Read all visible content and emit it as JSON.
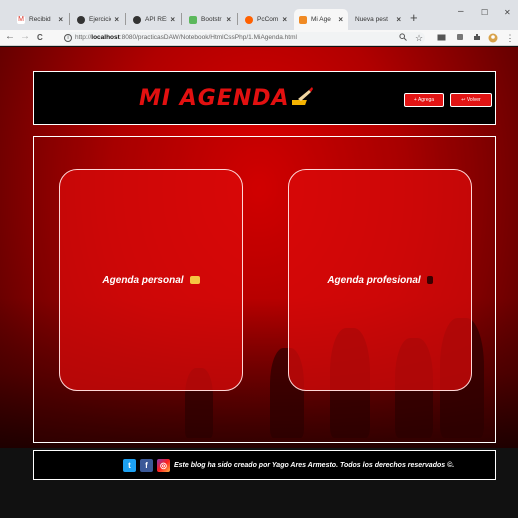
{
  "browser": {
    "tabs": [
      {
        "label": "Recibid",
        "favicon": "gmail-icon"
      },
      {
        "label": "Ejercicio",
        "favicon": "github-icon"
      },
      {
        "label": "API RES",
        "favicon": "github-icon"
      },
      {
        "label": "Bootstr",
        "favicon": "bootstrap-icon"
      },
      {
        "label": "PcCom",
        "favicon": "pccomponentes-icon"
      },
      {
        "label": "Mi Age",
        "favicon": "agenda-icon"
      },
      {
        "label": "Nueva pest",
        "favicon": ""
      }
    ],
    "close_glyph": "×",
    "new_tab_glyph": "+",
    "window_controls": {
      "minimize": "–",
      "maximize": "☐",
      "close": "✕"
    },
    "nav": {
      "back": "←",
      "forward": "→",
      "reload": "C"
    },
    "url": {
      "prefix": "http://",
      "host": "localhost",
      "path": ":8080/practicasDAW/Notebook/HtmlCssPhp/1.MiAgenda.html"
    }
  },
  "header": {
    "title": "MI AGENDA",
    "buttons": [
      {
        "label": "+ Agrega",
        "icon": "plus-icon"
      },
      {
        "label": "↩ Volver",
        "icon": "back-icon"
      }
    ]
  },
  "cards": [
    {
      "label": "Agenda personal",
      "icon": "notebook-emoji"
    },
    {
      "label": "Agenda profesional",
      "icon": "telephone-emoji"
    }
  ],
  "footer": {
    "social": [
      {
        "name": "twitter-icon",
        "glyph": "t",
        "color": "#1da1f2"
      },
      {
        "name": "facebook-icon",
        "glyph": "f",
        "color": "#3b5998"
      },
      {
        "name": "instagram-icon",
        "glyph": "◎",
        "color": "#c13584"
      }
    ],
    "text": "Este blog ha sido creado por Yago Ares Armesto. Todos los derechos reservados ©."
  },
  "colors": {
    "accent": "#e21010",
    "card": "#dc0a0a",
    "header_bg": "#000000"
  }
}
